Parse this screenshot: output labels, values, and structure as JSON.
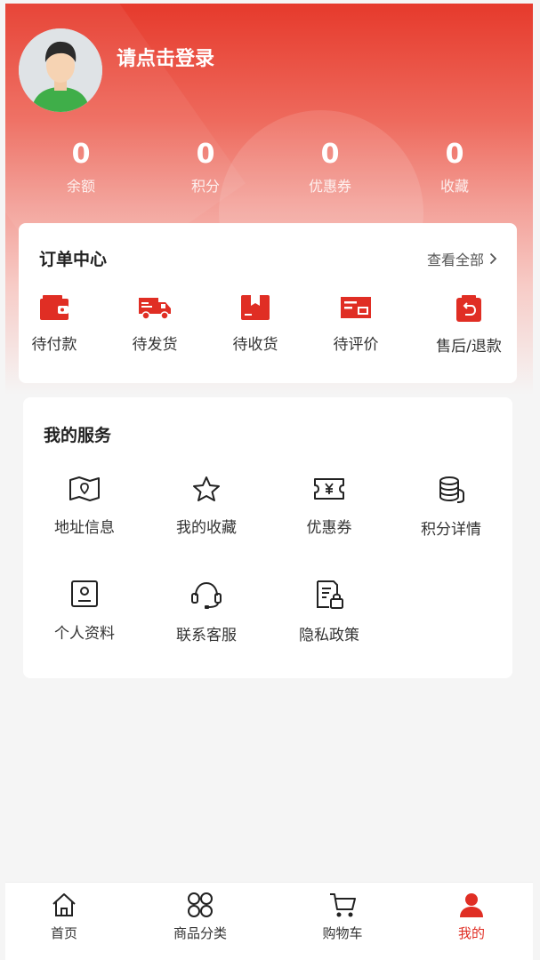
{
  "colors": {
    "accent": "#e02e24",
    "header_top": "#e63a2c",
    "background": "#f5f5f5"
  },
  "header": {
    "login_text": "请点击登录",
    "avatar_icon": "default-user-avatar"
  },
  "stats": [
    {
      "value": "0",
      "label": "余额"
    },
    {
      "value": "0",
      "label": "积分"
    },
    {
      "value": "0",
      "label": "优惠券"
    },
    {
      "value": "0",
      "label": "收藏"
    }
  ],
  "orders": {
    "title": "订单中心",
    "view_all": "查看全部",
    "items": [
      {
        "label": "待付款",
        "icon": "wallet-icon"
      },
      {
        "label": "待发货",
        "icon": "truck-icon"
      },
      {
        "label": "待收货",
        "icon": "package-icon"
      },
      {
        "label": "待评价",
        "icon": "review-icon"
      },
      {
        "label": "售后/退款",
        "icon": "refund-icon"
      }
    ]
  },
  "services": {
    "title": "我的服务",
    "items": [
      {
        "label": "地址信息",
        "icon": "map-icon"
      },
      {
        "label": "我的收藏",
        "icon": "star-icon"
      },
      {
        "label": "优惠券",
        "icon": "coupon-icon"
      },
      {
        "label": "积分详情",
        "icon": "coins-icon"
      },
      {
        "label": "个人资料",
        "icon": "profile-card-icon"
      },
      {
        "label": "联系客服",
        "icon": "headset-icon"
      },
      {
        "label": "隐私政策",
        "icon": "privacy-doc-icon"
      }
    ]
  },
  "tabbar": [
    {
      "label": "首页",
      "icon": "home-icon"
    },
    {
      "label": "商品分类",
      "icon": "category-icon"
    },
    {
      "label": "购物车",
      "icon": "cart-icon"
    },
    {
      "label": "我的",
      "icon": "user-icon",
      "active": true
    }
  ]
}
